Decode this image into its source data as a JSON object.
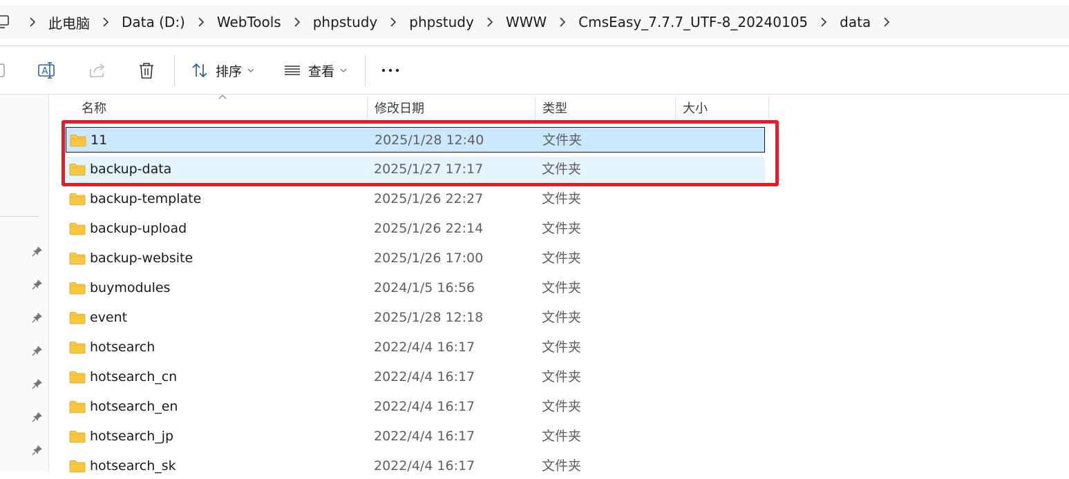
{
  "breadcrumb": [
    "此电脑",
    "Data (D:)",
    "WebTools",
    "phpstudy",
    "phpstudy",
    "WWW",
    "CmsEasy_7.7.7_UTF-8_20240105",
    "data"
  ],
  "toolbar": {
    "sort_label": "排序",
    "view_label": "查看"
  },
  "columns": {
    "name": "名称",
    "date": "修改日期",
    "type": "类型",
    "size": "大小"
  },
  "files": [
    {
      "name": "11",
      "date": "2025/1/28 12:40",
      "type": "文件夹",
      "state": "selected"
    },
    {
      "name": "backup-data",
      "date": "2025/1/27 17:17",
      "type": "文件夹",
      "state": "hovered"
    },
    {
      "name": "backup-template",
      "date": "2025/1/26 22:27",
      "type": "文件夹",
      "state": ""
    },
    {
      "name": "backup-upload",
      "date": "2025/1/26 22:14",
      "type": "文件夹",
      "state": ""
    },
    {
      "name": "backup-website",
      "date": "2025/1/26 17:00",
      "type": "文件夹",
      "state": ""
    },
    {
      "name": "buymodules",
      "date": "2024/1/5 16:56",
      "type": "文件夹",
      "state": ""
    },
    {
      "name": "event",
      "date": "2025/1/28 12:18",
      "type": "文件夹",
      "state": ""
    },
    {
      "name": "hotsearch",
      "date": "2022/4/4 16:17",
      "type": "文件夹",
      "state": ""
    },
    {
      "name": "hotsearch_cn",
      "date": "2022/4/4 16:17",
      "type": "文件夹",
      "state": ""
    },
    {
      "name": "hotsearch_en",
      "date": "2022/4/4 16:17",
      "type": "文件夹",
      "state": ""
    },
    {
      "name": "hotsearch_jp",
      "date": "2022/4/4 16:17",
      "type": "文件夹",
      "state": ""
    },
    {
      "name": "hotsearch_sk",
      "date": "2022/4/4 16:17",
      "type": "文件夹",
      "state": ""
    }
  ],
  "colors": {
    "selection": "#cce8ff",
    "hover": "#e5f3ff",
    "highlight_box": "#e11f2b",
    "folder": "#f8c842"
  }
}
